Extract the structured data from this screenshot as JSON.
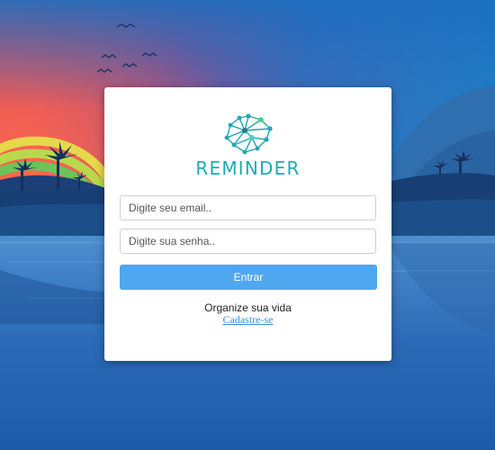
{
  "brand": {
    "name": "REMINDER",
    "logo_icon": "network-brain-icon",
    "color": "#1faab8"
  },
  "form": {
    "email_placeholder": "Digite seu email..",
    "password_placeholder": "Digite sua senha..",
    "submit_label": "Entrar"
  },
  "footer": {
    "tagline": "Organize sua vida",
    "signup_link": "Cadastre-se"
  },
  "colors": {
    "button": "#4fa7f0",
    "link": "#3a8be0",
    "card": "#ffffff"
  }
}
